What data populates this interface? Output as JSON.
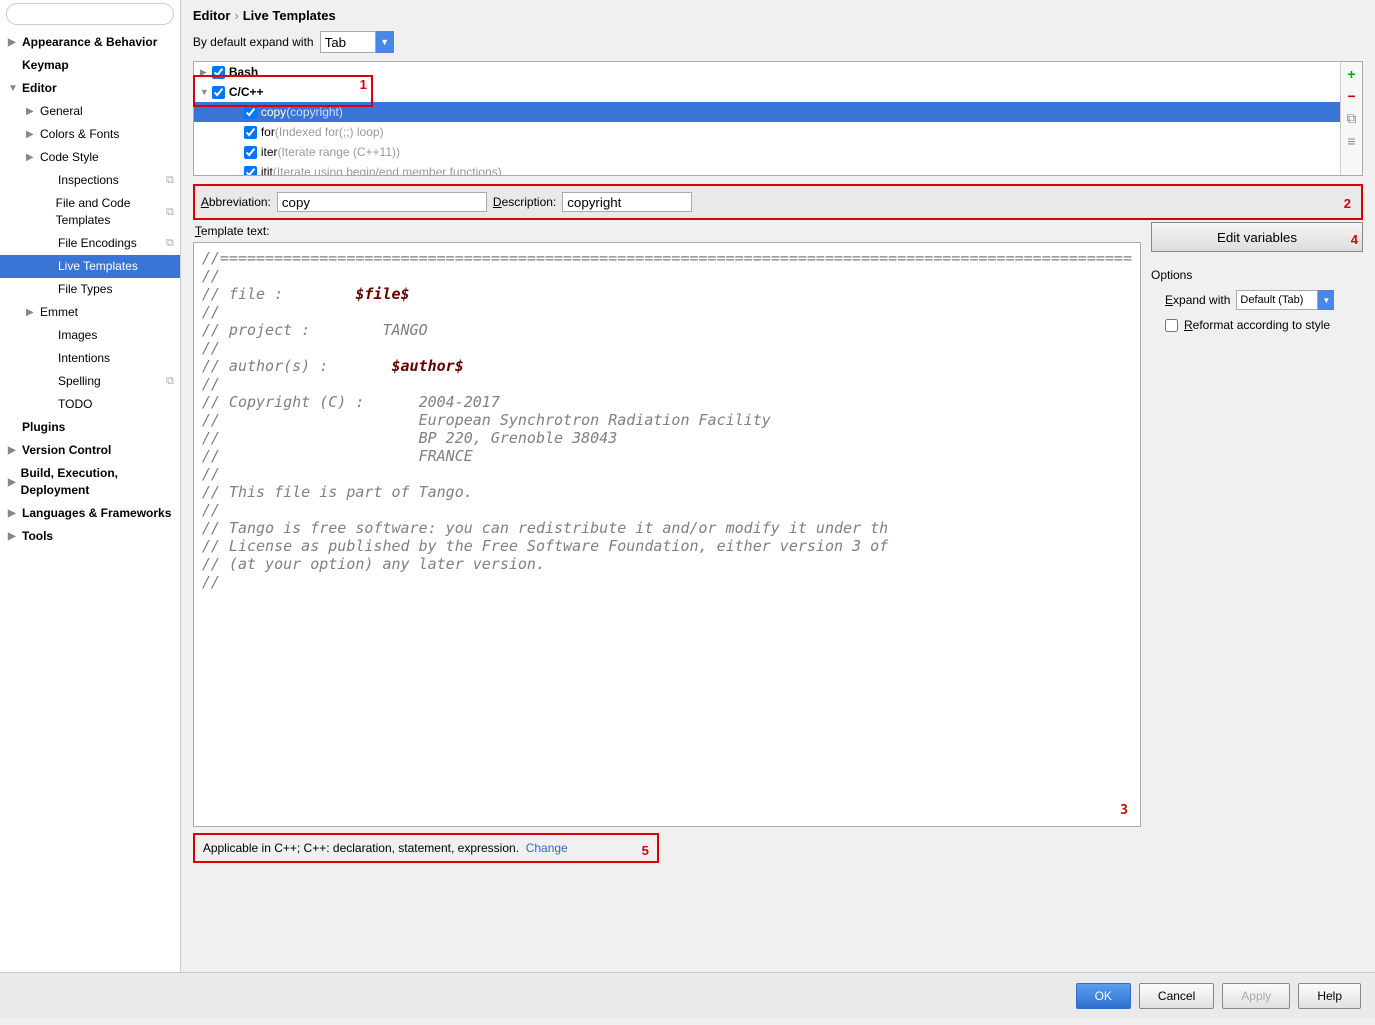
{
  "breadcrumb": {
    "a": "Editor",
    "b": "Live Templates"
  },
  "sidebar": {
    "search_ph": "",
    "items": [
      {
        "label": "Appearance & Behavior",
        "bold": true,
        "arrow": "▶",
        "indent": 0
      },
      {
        "label": "Keymap",
        "bold": true,
        "indent": 0
      },
      {
        "label": "Editor",
        "bold": true,
        "arrow": "▼",
        "indent": 0
      },
      {
        "label": "General",
        "arrow": "▶",
        "indent": 1
      },
      {
        "label": "Colors & Fonts",
        "arrow": "▶",
        "indent": 1
      },
      {
        "label": "Code Style",
        "arrow": "▶",
        "indent": 1
      },
      {
        "label": "Inspections",
        "indent": 2,
        "end": "⧉"
      },
      {
        "label": "File and Code Templates",
        "indent": 2,
        "end": "⧉"
      },
      {
        "label": "File Encodings",
        "indent": 2,
        "end": "⧉"
      },
      {
        "label": "Live Templates",
        "indent": 2,
        "selected": true
      },
      {
        "label": "File Types",
        "indent": 2
      },
      {
        "label": "Emmet",
        "arrow": "▶",
        "indent": 1
      },
      {
        "label": "Images",
        "indent": 2
      },
      {
        "label": "Intentions",
        "indent": 2
      },
      {
        "label": "Spelling",
        "indent": 2,
        "end": "⧉"
      },
      {
        "label": "TODO",
        "indent": 2
      },
      {
        "label": "Plugins",
        "bold": true,
        "indent": 0
      },
      {
        "label": "Version Control",
        "bold": true,
        "arrow": "▶",
        "indent": 0
      },
      {
        "label": "Build, Execution, Deployment",
        "bold": true,
        "arrow": "▶",
        "indent": 0
      },
      {
        "label": "Languages & Frameworks",
        "bold": true,
        "arrow": "▶",
        "indent": 0
      },
      {
        "label": "Tools",
        "bold": true,
        "arrow": "▶",
        "indent": 0
      }
    ]
  },
  "expand": {
    "label": "By default expand with",
    "value": "Tab"
  },
  "tree": [
    {
      "label": "Bash",
      "bold": true,
      "arrow": "▶",
      "level": 0,
      "checked": true
    },
    {
      "label": "C/C++",
      "bold": true,
      "arrow": "▼",
      "level": 0,
      "checked": true
    },
    {
      "label": "copy",
      "hint": "(copyright)",
      "level": 2,
      "checked": true,
      "sel": true
    },
    {
      "label": "for",
      "hint": "(Indexed for(;;) loop)",
      "level": 2,
      "checked": true
    },
    {
      "label": "iter",
      "hint": "(Iterate range (C++11))",
      "level": 2,
      "checked": true
    },
    {
      "label": "itit",
      "hint": "(Iterate using begin/end member functions)",
      "level": 2,
      "checked": true
    }
  ],
  "abbr": {
    "abbr_l": "Abbreviation:",
    "abbr_v": "copy",
    "desc_l": "Description:",
    "desc_v": "copyright"
  },
  "tmpl_label": "Template text:",
  "tmpl": {
    "l01": "//=====================================================================================================",
    "l02": "//",
    "l03a": "// file :        ",
    "l03v": "$file$",
    "l04": "//",
    "l05": "// project :        TANGO",
    "l06": "//",
    "l07a": "// author(s) :       ",
    "l07v": "$author$",
    "l08": "//",
    "l09": "// Copyright (C) :      2004-2017",
    "l10": "//                      European Synchrotron Radiation Facility",
    "l11": "//                      BP 220, Grenoble 38043",
    "l12": "//                      FRANCE",
    "l13": "//",
    "l14": "// This file is part of Tango.",
    "l15": "//",
    "l16": "// Tango is free software: you can redistribute it and/or modify it under th",
    "l17": "// License as published by the Free Software Foundation, either version 3 of",
    "l18": "// (at your option) any later version.",
    "l19": "//"
  },
  "editvar": "Edit variables",
  "options": {
    "header": "Options",
    "expand_l": "Expand with",
    "expand_v": "Default (Tab)",
    "reformat": "Reformat according to style"
  },
  "applicable": {
    "text": "Applicable in C++; C++: declaration, statement, expression.",
    "change": "Change"
  },
  "footer": {
    "ok": "OK",
    "cancel": "Cancel",
    "apply": "Apply",
    "help": "Help"
  },
  "annot": {
    "n1": "1",
    "n2": "2",
    "n3": "3",
    "n4": "4",
    "n5": "5"
  }
}
